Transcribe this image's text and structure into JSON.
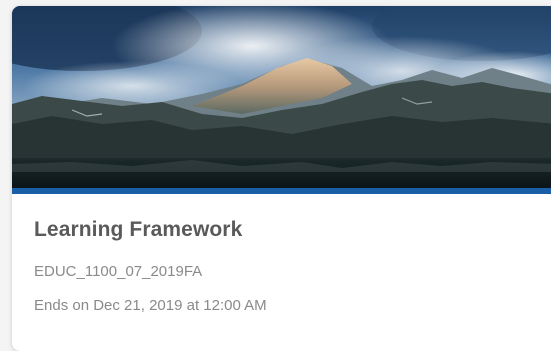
{
  "course_card": {
    "title": "Learning Framework",
    "code": "EDUC_1100_07_2019FA",
    "end_date": "Ends on Dec 21, 2019 at 12:00 AM",
    "accent_color": "#1a5ea8",
    "banner_image": "mountain-lake-landscape"
  }
}
